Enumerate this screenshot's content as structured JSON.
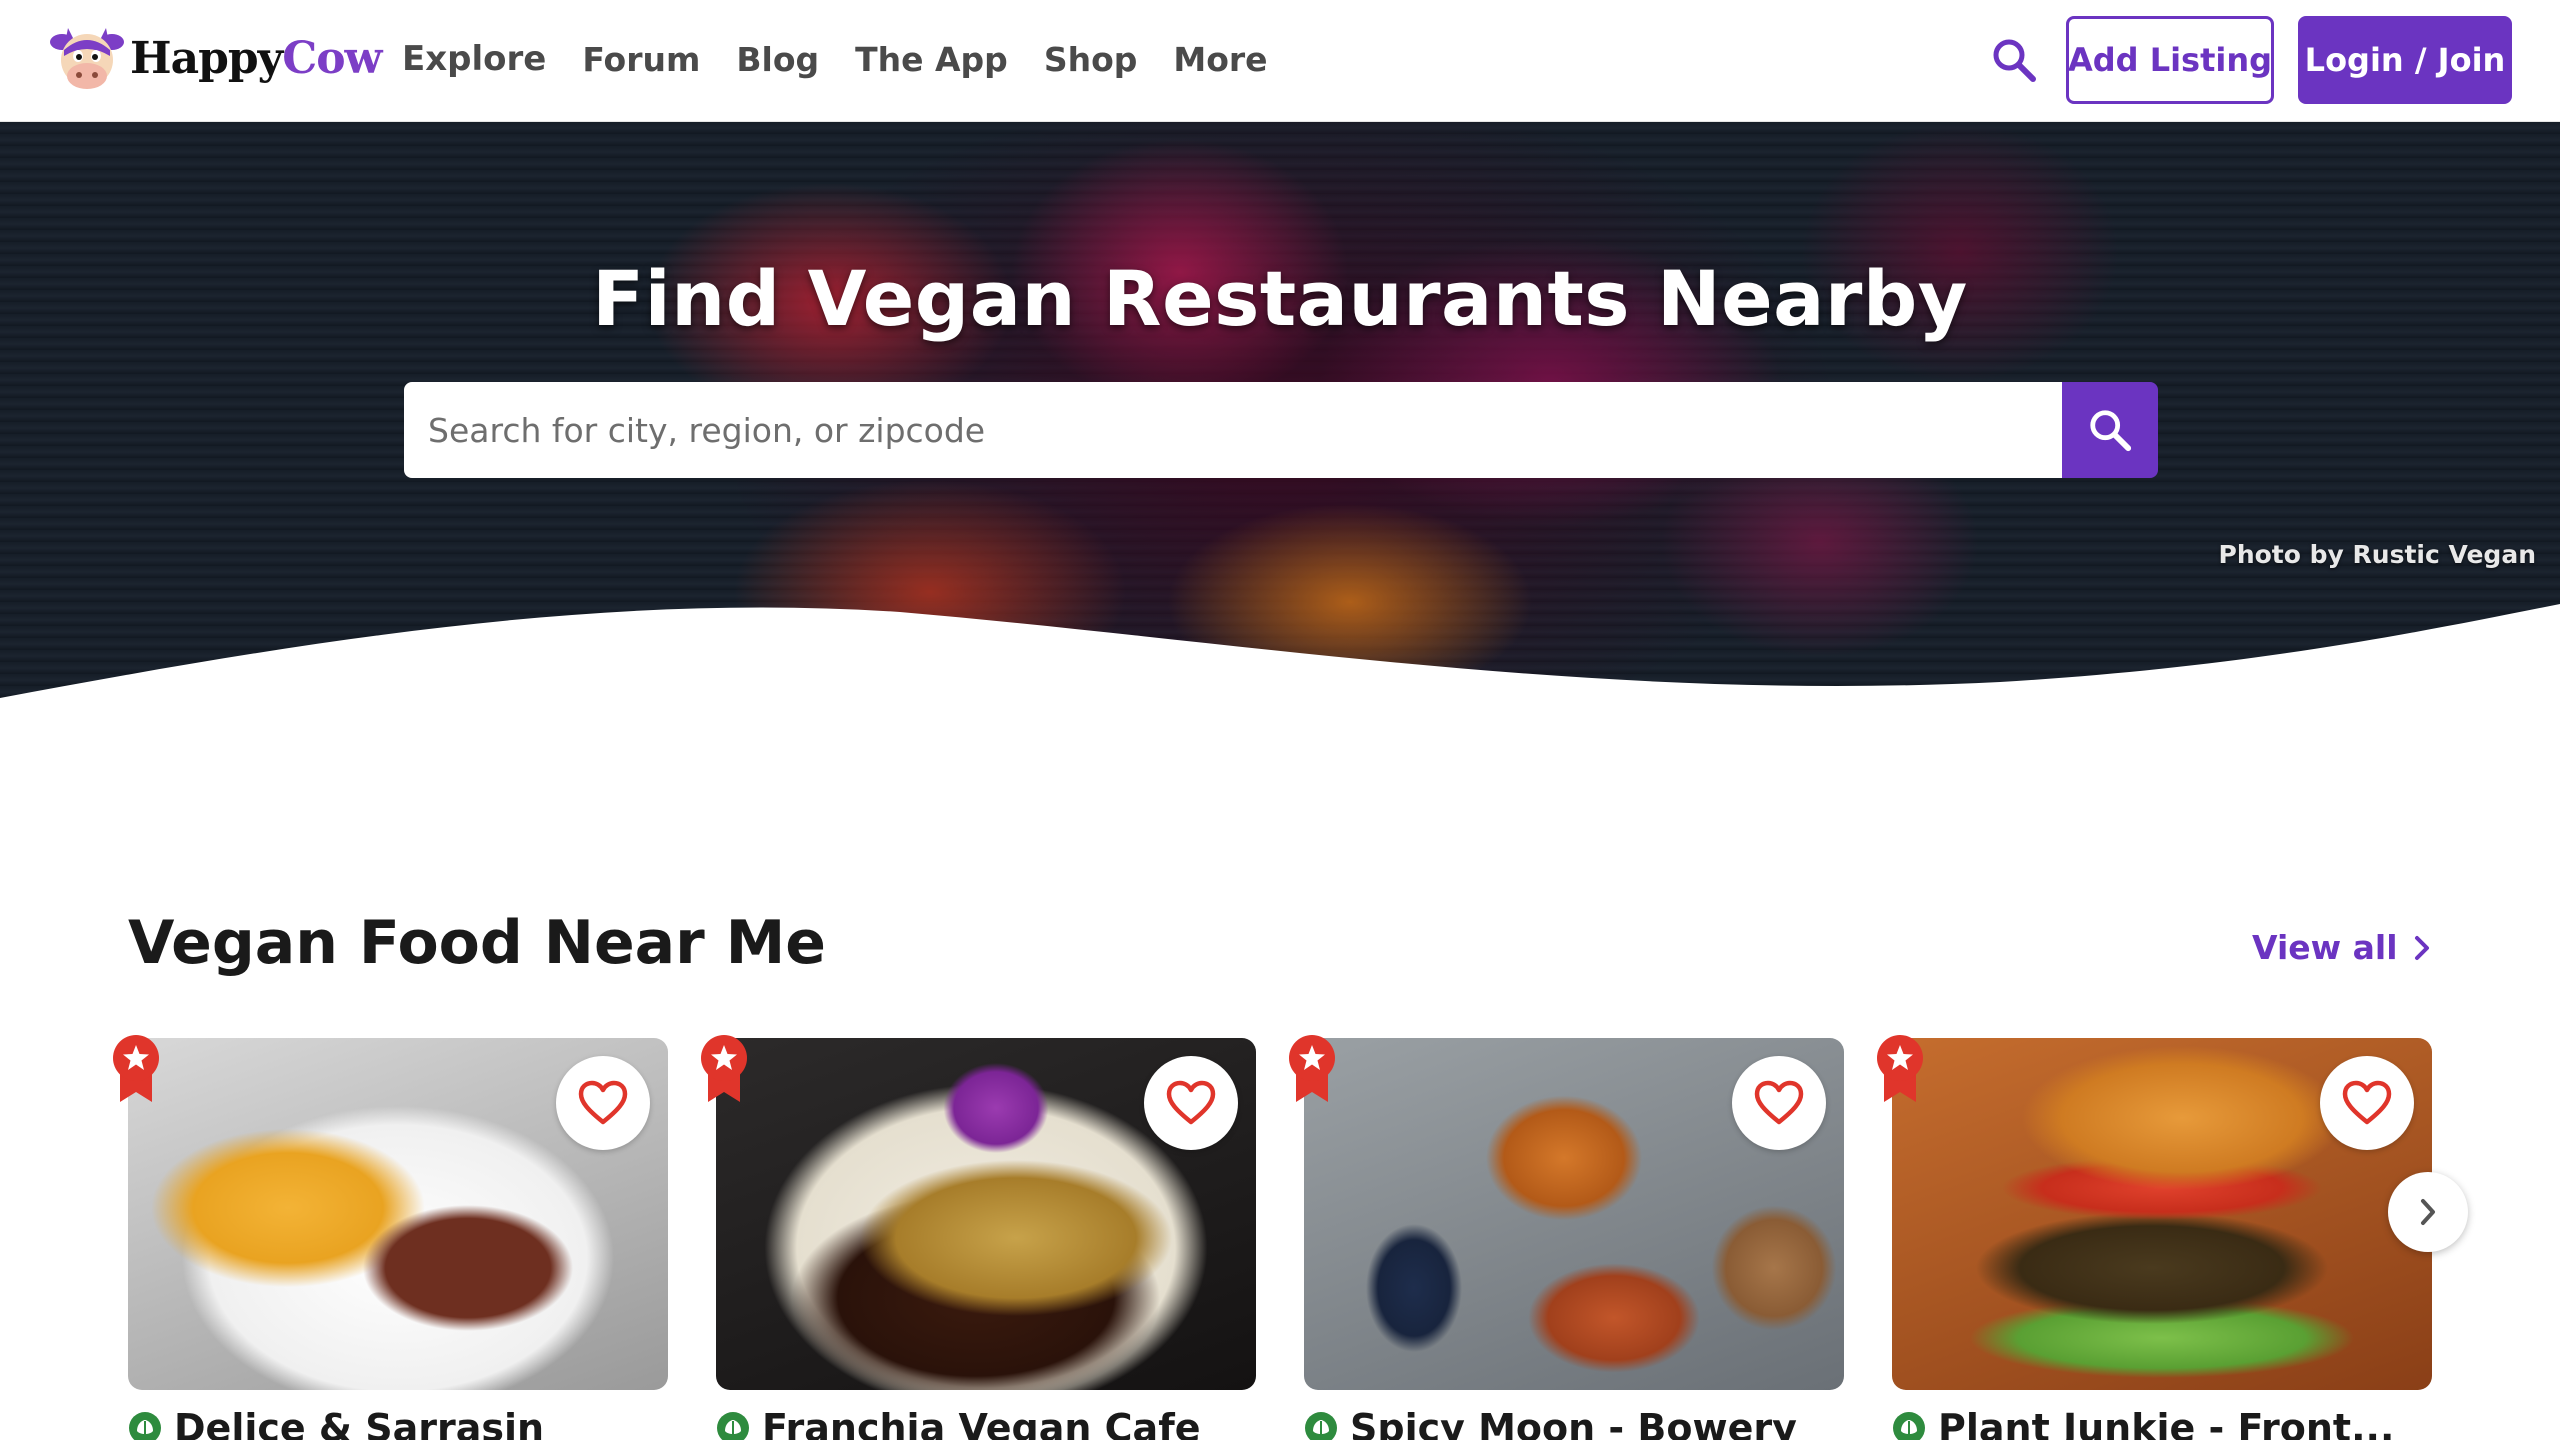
{
  "header": {
    "logo": {
      "word1": "Happy",
      "word2": "Cow"
    },
    "nav": [
      "Explore",
      "Forum",
      "Blog",
      "The App",
      "Shop",
      "More"
    ],
    "add_listing": "Add Listing",
    "login": "Login / Join",
    "icons": {
      "search": "search-icon"
    }
  },
  "hero": {
    "title": "Find Vegan Restaurants Nearby",
    "search_placeholder": "Search for city, region, or zipcode",
    "photo_credit": "Photo by Rustic Vegan"
  },
  "section": {
    "title": "Vegan Food Near Me",
    "view_all": "View all"
  },
  "cards": [
    {
      "name": "Delice & Sarrasin"
    },
    {
      "name": "Franchia Vegan Cafe"
    },
    {
      "name": "Spicy Moon - Bowery"
    },
    {
      "name": "Plant Junkie - Front..."
    }
  ],
  "colors": {
    "brand": "#6b34c1",
    "heart": "#e0352b",
    "badge": "#e0352b",
    "vegan_leaf": "#2e8b3e"
  }
}
